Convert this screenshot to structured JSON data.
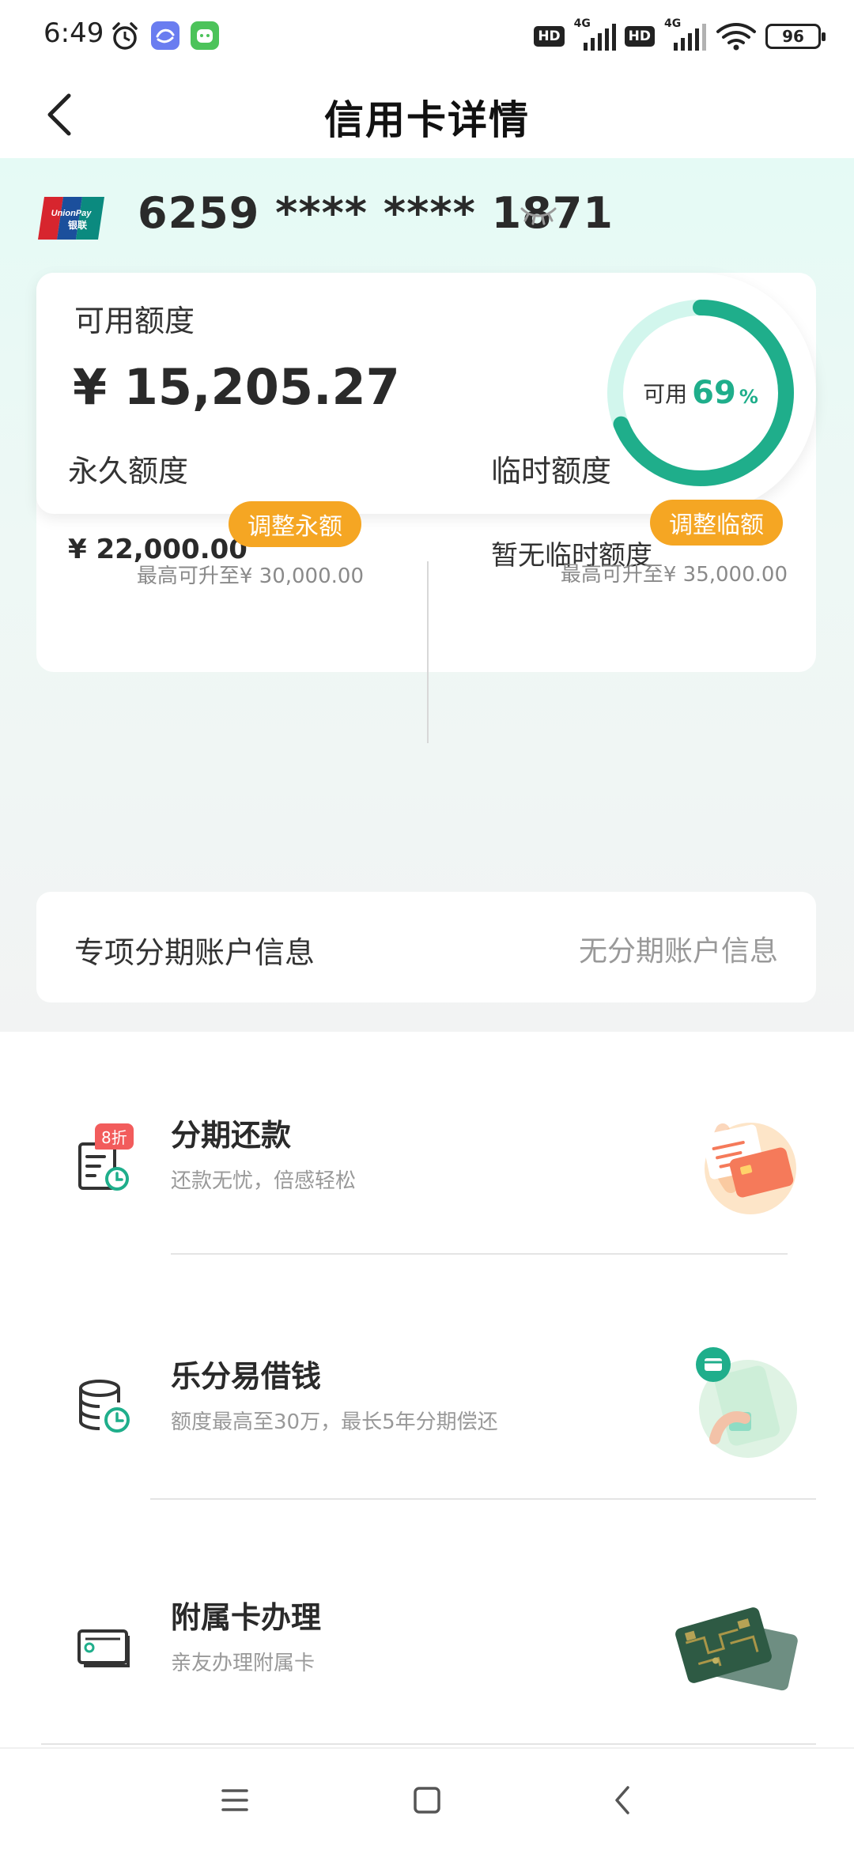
{
  "status_bar": {
    "time": "6:49",
    "network_1": "4G",
    "network_2": "4G",
    "hd_1": "HD",
    "hd_2": "HD",
    "battery": "96"
  },
  "header": {
    "title": "信用卡详情"
  },
  "card": {
    "brand_text": "UnionPay 银联",
    "number": "6259 **** **** 1871"
  },
  "available": {
    "label": "可用额度",
    "amount": "¥ 15,205.27",
    "ring_label": "可用",
    "ring_percent": "69",
    "ring_percent_sign": "%",
    "ring_fraction": 0.69,
    "ring_color": "#1fae8b",
    "ring_track_color": "#d2f6ed"
  },
  "permanent": {
    "title": "永久额度",
    "value": "¥ 22,000.00",
    "button": "调整永额",
    "max_note": "最高可升至¥ 30,000.00"
  },
  "temporary": {
    "title": "临时额度",
    "value": "暂无临时额度",
    "button": "调整临额",
    "max_note": "最高可升至¥ 35,000.00"
  },
  "installment_account": {
    "label": "专项分期账户信息",
    "value": "无分期账户信息"
  },
  "services": [
    {
      "title": "分期还款",
      "subtitle": "还款无忧，倍感轻松",
      "badge": "8折",
      "icon": "installment-doc-icon"
    },
    {
      "title": "乐分易借钱",
      "subtitle": "额度最高至30万，最长5年分期偿还",
      "icon": "coin-stack-icon"
    },
    {
      "title": "附属卡办理",
      "subtitle": "亲友办理附属卡",
      "icon": "card-icon"
    }
  ],
  "nav": {
    "menu_icon": "menu-icon",
    "home_icon": "home-icon",
    "back_icon": "back-icon"
  },
  "colors": {
    "accent_green": "#1fae8b",
    "button_orange": "#f5a623",
    "badge_red": "#f25c5c"
  }
}
